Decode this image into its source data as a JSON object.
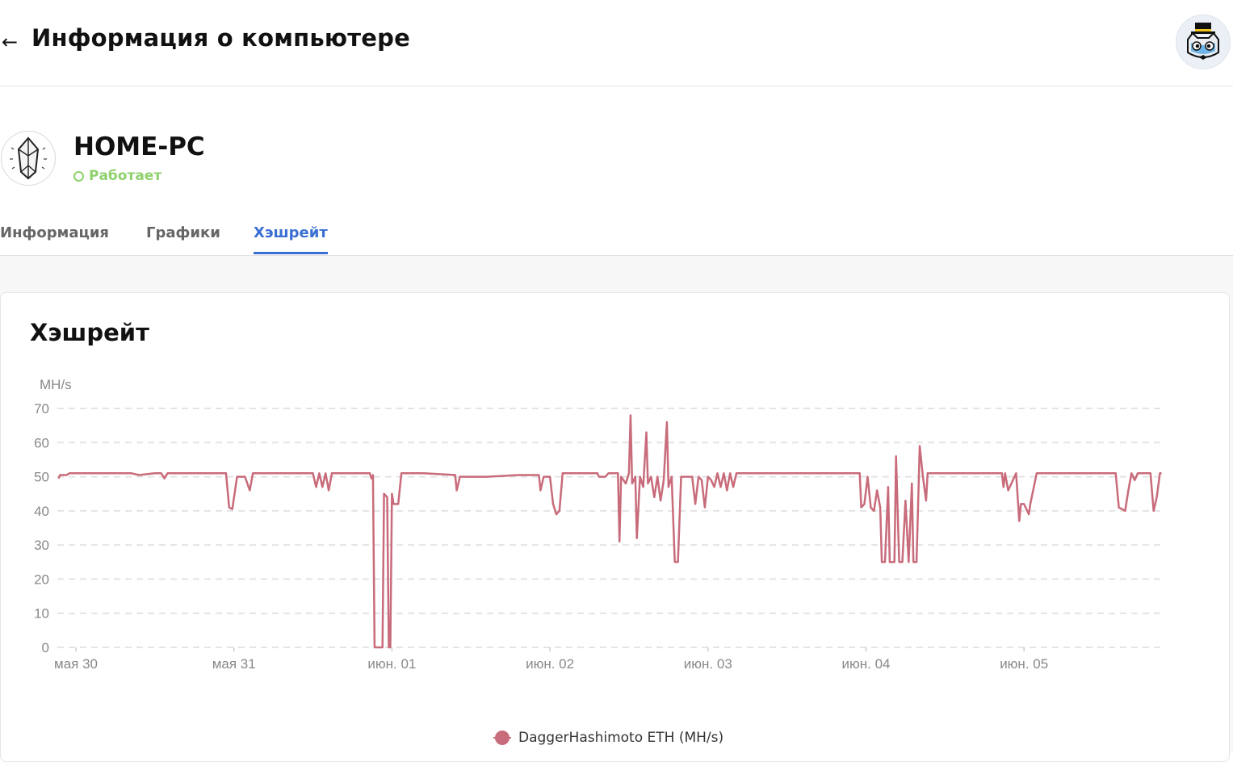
{
  "header": {
    "back_icon": "arrow-left-icon",
    "title": "Информация о компьютере",
    "avatar_icon": "cat-with-top-hat-avatar-icon"
  },
  "rig": {
    "icon": "crystal-icon",
    "name": "HOME-PC",
    "status": "Работает",
    "status_color": "#8fd16c"
  },
  "tabs": [
    {
      "label": "Информация",
      "active": false
    },
    {
      "label": "Графики",
      "active": false
    },
    {
      "label": "Хэшрейт",
      "active": true
    }
  ],
  "accent_color": "#3b6fd4",
  "card": {
    "title": "Хэшрейт"
  },
  "chart_data": {
    "type": "line",
    "title": "Хэшрейт",
    "ylabel": "MH/s",
    "ylim": [
      0,
      70
    ],
    "yticks": [
      0,
      10,
      20,
      30,
      40,
      50,
      60,
      70
    ],
    "x_start": "мая 29 23:00",
    "x_end": "июн. 05 22:00",
    "xticks": [
      {
        "t": 1,
        "label": "мая 30"
      },
      {
        "t": 2,
        "label": "мая 31"
      },
      {
        "t": 3,
        "label": "июн. 01"
      },
      {
        "t": 4,
        "label": "июн. 02"
      },
      {
        "t": 5,
        "label": "июн. 03"
      },
      {
        "t": 6,
        "label": "июн. 04"
      },
      {
        "t": 7,
        "label": "июн. 05"
      }
    ],
    "grid": true,
    "legend_position": "bottom-center",
    "series": [
      {
        "name": "DaggerHashimoto ETH (MH/s)",
        "color": "#c86b7a",
        "points": [
          [
            0.89,
            49.5
          ],
          [
            0.9,
            50.5
          ],
          [
            0.94,
            50.5
          ],
          [
            0.96,
            51
          ],
          [
            1.2,
            51
          ],
          [
            1.35,
            51
          ],
          [
            1.4,
            50.5
          ],
          [
            1.5,
            51
          ],
          [
            1.54,
            51
          ],
          [
            1.56,
            49.5
          ],
          [
            1.58,
            51
          ],
          [
            1.95,
            51
          ],
          [
            1.97,
            41
          ],
          [
            1.99,
            40.5
          ],
          [
            2.02,
            50
          ],
          [
            2.07,
            50
          ],
          [
            2.1,
            46
          ],
          [
            2.12,
            51
          ],
          [
            2.5,
            51
          ],
          [
            2.52,
            47
          ],
          [
            2.54,
            51
          ],
          [
            2.56,
            47
          ],
          [
            2.58,
            51
          ],
          [
            2.6,
            46
          ],
          [
            2.62,
            51
          ],
          [
            2.86,
            51
          ],
          [
            2.87,
            49.5
          ],
          [
            2.88,
            50.5
          ],
          [
            2.89,
            0
          ],
          [
            2.94,
            0
          ],
          [
            2.95,
            45
          ],
          [
            2.97,
            44
          ],
          [
            2.98,
            0
          ],
          [
            2.99,
            0
          ],
          [
            3.0,
            45
          ],
          [
            3.01,
            42
          ],
          [
            3.04,
            42
          ],
          [
            3.06,
            51
          ],
          [
            3.2,
            51
          ],
          [
            3.4,
            50.5
          ],
          [
            3.41,
            46
          ],
          [
            3.43,
            50
          ],
          [
            3.6,
            50
          ],
          [
            3.8,
            50.5
          ],
          [
            3.93,
            50.5
          ],
          [
            3.94,
            46
          ],
          [
            3.96,
            50
          ],
          [
            4.0,
            50
          ],
          [
            4.02,
            42
          ],
          [
            4.04,
            39
          ],
          [
            4.06,
            40
          ],
          [
            4.08,
            51
          ],
          [
            4.3,
            51
          ],
          [
            4.31,
            50
          ],
          [
            4.35,
            50
          ],
          [
            4.37,
            51
          ],
          [
            4.43,
            51
          ],
          [
            4.44,
            31
          ],
          [
            4.45,
            50
          ],
          [
            4.48,
            48
          ],
          [
            4.5,
            51
          ],
          [
            4.51,
            68
          ],
          [
            4.52,
            48
          ],
          [
            4.54,
            50
          ],
          [
            4.55,
            32
          ],
          [
            4.57,
            50
          ],
          [
            4.59,
            47
          ],
          [
            4.61,
            63
          ],
          [
            4.62,
            48
          ],
          [
            4.64,
            50
          ],
          [
            4.66,
            44
          ],
          [
            4.68,
            50
          ],
          [
            4.7,
            43
          ],
          [
            4.72,
            49
          ],
          [
            4.74,
            66
          ],
          [
            4.75,
            47
          ],
          [
            4.77,
            50
          ],
          [
            4.79,
            25
          ],
          [
            4.81,
            25
          ],
          [
            4.83,
            50
          ],
          [
            4.9,
            50
          ],
          [
            4.92,
            42
          ],
          [
            4.94,
            50
          ],
          [
            4.96,
            49
          ],
          [
            4.98,
            41
          ],
          [
            5.0,
            50
          ],
          [
            5.02,
            49
          ],
          [
            5.04,
            47
          ],
          [
            5.06,
            51
          ],
          [
            5.08,
            47
          ],
          [
            5.1,
            51
          ],
          [
            5.12,
            46
          ],
          [
            5.14,
            51
          ],
          [
            5.16,
            47
          ],
          [
            5.18,
            51
          ],
          [
            5.2,
            51
          ],
          [
            5.5,
            51
          ],
          [
            5.9,
            51
          ],
          [
            5.96,
            51
          ],
          [
            5.97,
            41
          ],
          [
            5.99,
            42
          ],
          [
            6.01,
            50
          ],
          [
            6.03,
            41
          ],
          [
            6.05,
            40
          ],
          [
            6.07,
            46
          ],
          [
            6.09,
            41
          ],
          [
            6.1,
            25
          ],
          [
            6.12,
            25
          ],
          [
            6.14,
            47
          ],
          [
            6.15,
            25
          ],
          [
            6.18,
            25
          ],
          [
            6.19,
            56
          ],
          [
            6.21,
            25
          ],
          [
            6.23,
            25
          ],
          [
            6.25,
            43
          ],
          [
            6.27,
            25
          ],
          [
            6.29,
            48
          ],
          [
            6.3,
            25
          ],
          [
            6.32,
            25
          ],
          [
            6.34,
            59
          ],
          [
            6.36,
            50
          ],
          [
            6.38,
            43
          ],
          [
            6.39,
            51
          ],
          [
            6.6,
            51
          ],
          [
            6.86,
            51
          ],
          [
            6.87,
            47
          ],
          [
            6.88,
            51
          ],
          [
            6.9,
            46
          ],
          [
            6.92,
            48
          ],
          [
            6.95,
            51
          ],
          [
            6.97,
            37
          ],
          [
            6.98,
            42
          ],
          [
            7.0,
            42
          ],
          [
            7.03,
            39
          ],
          [
            7.04,
            42
          ],
          [
            7.08,
            51
          ],
          [
            7.5,
            51
          ],
          [
            7.58,
            51
          ],
          [
            7.6,
            41
          ],
          [
            7.62,
            40.5
          ],
          [
            7.64,
            40
          ],
          [
            7.66,
            46
          ],
          [
            7.68,
            51
          ],
          [
            7.7,
            49
          ],
          [
            7.72,
            51
          ],
          [
            7.8,
            51
          ],
          [
            7.82,
            40
          ],
          [
            7.84,
            44
          ],
          [
            7.86,
            51
          ],
          [
            7.87,
            51
          ]
        ]
      }
    ]
  }
}
